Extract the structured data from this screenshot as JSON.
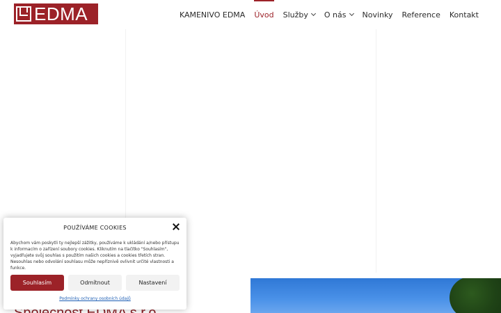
{
  "brand": {
    "logo_text": "EDMA",
    "accent_color": "#9c2228"
  },
  "nav": {
    "items": [
      {
        "label": "KAMENIVO EDMA",
        "active": false,
        "has_dropdown": false
      },
      {
        "label": "Úvod",
        "active": true,
        "has_dropdown": false
      },
      {
        "label": "Služby",
        "active": false,
        "has_dropdown": true
      },
      {
        "label": "O nás",
        "active": false,
        "has_dropdown": true
      },
      {
        "label": "Novinky",
        "active": false,
        "has_dropdown": false
      },
      {
        "label": "Reference",
        "active": false,
        "has_dropdown": false
      },
      {
        "label": "Kontakt",
        "active": false,
        "has_dropdown": false
      }
    ]
  },
  "hero": {
    "headline": "Společnost EDMA s.r.o."
  },
  "cookie": {
    "title": "POUŽÍVÁME COOKIES",
    "text": "Abychom vám poskytli ty nejlepší zážitky, používáme k ukládání a/nebo přístupu k informacím o zařízení soubory cookies. Kliknutím na tlačítko \"Souhlasím\", vyjadřujete svůj souhlas s použitím našich cookies a cookies třetích stran. Nesouhlas nebo odvolání souhlasu může nepříznivě ovlivnit určité vlastnosti a funkce.",
    "accept_label": "Souhlasím",
    "decline_label": "Odmítnout",
    "settings_label": "Nastavení",
    "policy_link": "Podmínky ochrany osobních údajů"
  },
  "icons": {
    "close": "close-icon",
    "dropdown": "chevron-down-icon"
  }
}
